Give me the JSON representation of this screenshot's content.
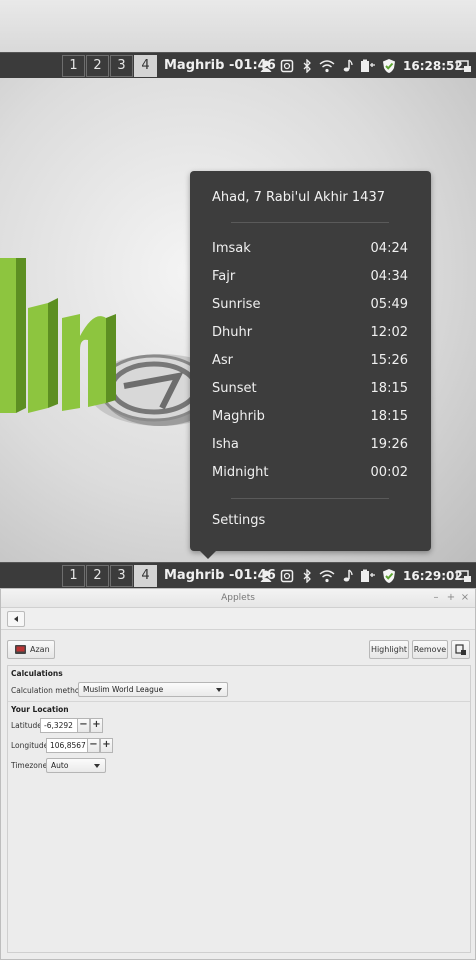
{
  "top_panel": {
    "workspaces": [
      "1",
      "2",
      "3",
      "4"
    ],
    "active_workspace": "4",
    "azan_applet": "Maghrib -01:46",
    "clock": "16:28:52"
  },
  "popup": {
    "date": "Ahad, 7 Rabi'ul Akhir 1437",
    "prayers": [
      {
        "name": "Imsak",
        "time": "04:24"
      },
      {
        "name": "Fajr",
        "time": "04:34"
      },
      {
        "name": "Sunrise",
        "time": "05:49"
      },
      {
        "name": "Dhuhr",
        "time": "12:02"
      },
      {
        "name": "Asr",
        "time": "15:26"
      },
      {
        "name": "Sunset",
        "time": "18:15"
      },
      {
        "name": "Maghrib",
        "time": "18:15"
      },
      {
        "name": "Isha",
        "time": "19:26"
      },
      {
        "name": "Midnight",
        "time": "00:02"
      }
    ],
    "settings_label": "Settings"
  },
  "bottom_panel": {
    "workspaces": [
      "1",
      "2",
      "3",
      "4"
    ],
    "active_workspace": "4",
    "azan_applet": "Maghrib -01:46",
    "clock": "16:29:02"
  },
  "window": {
    "title": "Applets",
    "controls": [
      "–",
      "+",
      "×"
    ],
    "applet_button": "Azan",
    "highlight_button": "Highlight",
    "remove_button": "Remove",
    "calculations": {
      "heading": "Calculations",
      "method_label": "Calculation method",
      "method_value": "Muslim World League"
    },
    "location": {
      "heading": "Your Location",
      "latitude_label": "Latitude",
      "latitude_value": "-6,3292",
      "longitude_label": "Longitude",
      "longitude_value": "106,8567",
      "timezone_label": "Timezone",
      "timezone_value": "Auto"
    }
  },
  "colors": {
    "panel": "#3b3b3b",
    "popup": "#3d3d3d",
    "mint_green": "#8cc63f"
  }
}
